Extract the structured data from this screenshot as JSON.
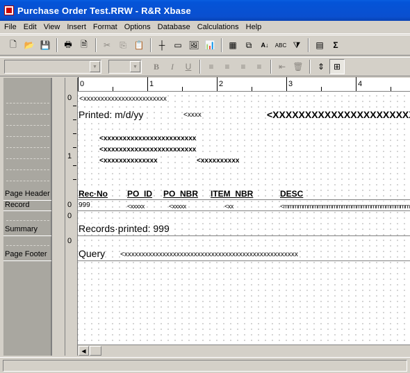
{
  "window": {
    "title": "Purchase Order Test.RRW - R&R Xbase"
  },
  "menu": [
    "File",
    "Edit",
    "View",
    "Insert",
    "Format",
    "Options",
    "Database",
    "Calculations",
    "Help"
  ],
  "toolbar": {
    "new": "🗋",
    "open": "📂",
    "save": "💾",
    "print": "🖶",
    "preview": "🗎",
    "cut": "✂",
    "copy": "⎘",
    "paste": "📋",
    "line": "┼",
    "box": "▭",
    "picture": "🖼",
    "chart": "📊",
    "table": "▦",
    "link": "⧉",
    "sort": "A↓",
    "abc": "ABC",
    "filter": "⧩",
    "calc": "▤",
    "sum": "Σ"
  },
  "format_toolbar": {
    "bold": "B",
    "italic": "I",
    "underline": "U",
    "align_left": "≡",
    "align_center": "≡",
    "align_right": "≡",
    "justify": "≡",
    "indent": "⇤",
    "delete": "🗑",
    "height": "⇕",
    "grid": "⊞"
  },
  "bands": {
    "page_header": "Page Header",
    "record": "Record",
    "summary": "Summary",
    "page_footer": "Page Footer"
  },
  "gutter_numbers": {
    "header_0": "0",
    "header_1": "1",
    "record_0": "0",
    "summary_0": "0",
    "footer_0": "0"
  },
  "ruler": [
    "0",
    "1",
    "2",
    "3",
    "4"
  ],
  "fields": {
    "title_field": "<xxxxxxxxxxxxxxxxxxxxxxxx",
    "printed": "Printed:  m/d/yy",
    "printed_time": "<xxxx",
    "company": "<XXXXXXXXXXXXXXXXXXXXXXXXXXXX",
    "addr1": "<xxxxxxxxxxxxxxxxxxxxxxxx",
    "addr2": "<xxxxxxxxxxxxxxxxxxxxxxxx",
    "addr3a": "<xxxxxxxxxxxxxx",
    "addr3b": "<xxxxxxxxxx",
    "hdr_recno": "Rec·No",
    "hdr_poid": "PO_ID",
    "hdr_ponbr": "PO_NBR",
    "hdr_itemnbr": "ITEM_NBR",
    "hdr_desc": "DESC",
    "rec_999": "999",
    "rec_poid": "<xxxxx",
    "rec_ponbr": "<xxxxx",
    "rec_item": "<xx",
    "rec_desc": "<mmmmmmmmmmmmmmmmmmmmmmmmmm",
    "summary_text": "Records·printed:  999",
    "query_label": "Query",
    "query_field": "<xxxxxxxxxxxxxxxxxxxxxxxxxxxxxxxxxxxxxxxxxxxxxxxxxx"
  }
}
